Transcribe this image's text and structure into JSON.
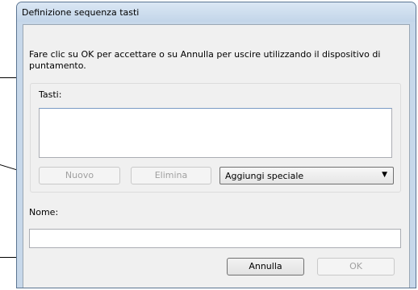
{
  "dialog": {
    "title": "Definizione sequenza tasti",
    "instruction": "Fare clic su OK per accettare o su Annulla per uscire utilizzando il dispositivo di puntamento.",
    "keys_label": "Tasti:",
    "keys_value": "",
    "buttons": {
      "new": "Nuovo",
      "delete": "Elimina",
      "cancel": "Annulla",
      "ok": "OK"
    },
    "special_select": {
      "selected": "Aggiungi speciale"
    },
    "name_label": "Nome:",
    "name_value": ""
  }
}
